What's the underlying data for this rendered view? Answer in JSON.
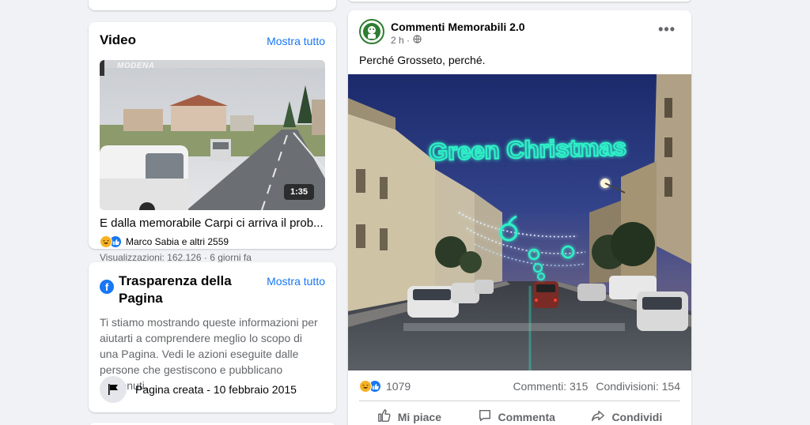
{
  "video_card": {
    "title": "Video",
    "show_all": "Mostra tutto",
    "watermark": "MODENA",
    "duration": "1:35",
    "video_title": "E dalla memorabile Carpi ci arriva il prob...",
    "reactors": "Marco Sabia e altri 2559",
    "views": "Visualizzazioni: 162.126 · 6 giorni fa"
  },
  "transparency_card": {
    "title": "Trasparenza della Pagina",
    "show_all": "Mostra tutto",
    "description": "Ti stiamo mostrando queste informazioni per aiutarti a comprendere meglio lo scopo di una Pagina. Vedi le azioni eseguite dalle persone che gestiscono e pubblicano contenuti.",
    "page_created": "Pagina creata - 10 febbraio 2015"
  },
  "post": {
    "author": "Commenti Memorabili 2.0",
    "time": "2 h ·",
    "more_icon": "more-icon",
    "text": "Perché Grosseto, perché.",
    "image_sign": "Green Christmas",
    "reaction_count": "1079",
    "comments": "Commenti: 315",
    "shares": "Condivisioni: 154",
    "actions": {
      "like": "Mi piace",
      "comment": "Commenta",
      "share": "Condividi"
    }
  },
  "colors": {
    "accent": "#1877f2",
    "background": "#f0f2f5",
    "neon": "#2ef2c8"
  }
}
